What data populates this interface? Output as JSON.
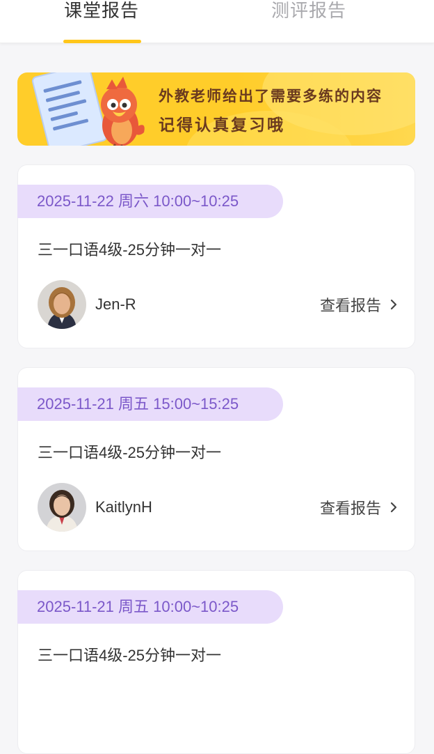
{
  "tabs": [
    {
      "label": "课堂报告",
      "active": true
    },
    {
      "label": "测评报告",
      "active": false
    }
  ],
  "banner": {
    "line1": "外教老师给出了需要多练的内容",
    "line2": "记得认真复习哦"
  },
  "cards": [
    {
      "date": "2025-11-22 周六 10:00~10:25",
      "course": "三一口语4级-25分钟一对一",
      "teacher": "Jen-R",
      "action": "查看报告"
    },
    {
      "date": "2025-11-21 周五 15:00~15:25",
      "course": "三一口语4级-25分钟一对一",
      "teacher": "KaitlynH",
      "action": "查看报告"
    },
    {
      "date": "2025-11-21 周五 10:00~10:25",
      "course": "三一口语4级-25分钟一对一",
      "teacher": "",
      "action": ""
    }
  ],
  "colors": {
    "accent_yellow": "#ffc61a",
    "date_pill_bg": "#e8dcfb",
    "date_pill_text": "#7b58c9"
  }
}
